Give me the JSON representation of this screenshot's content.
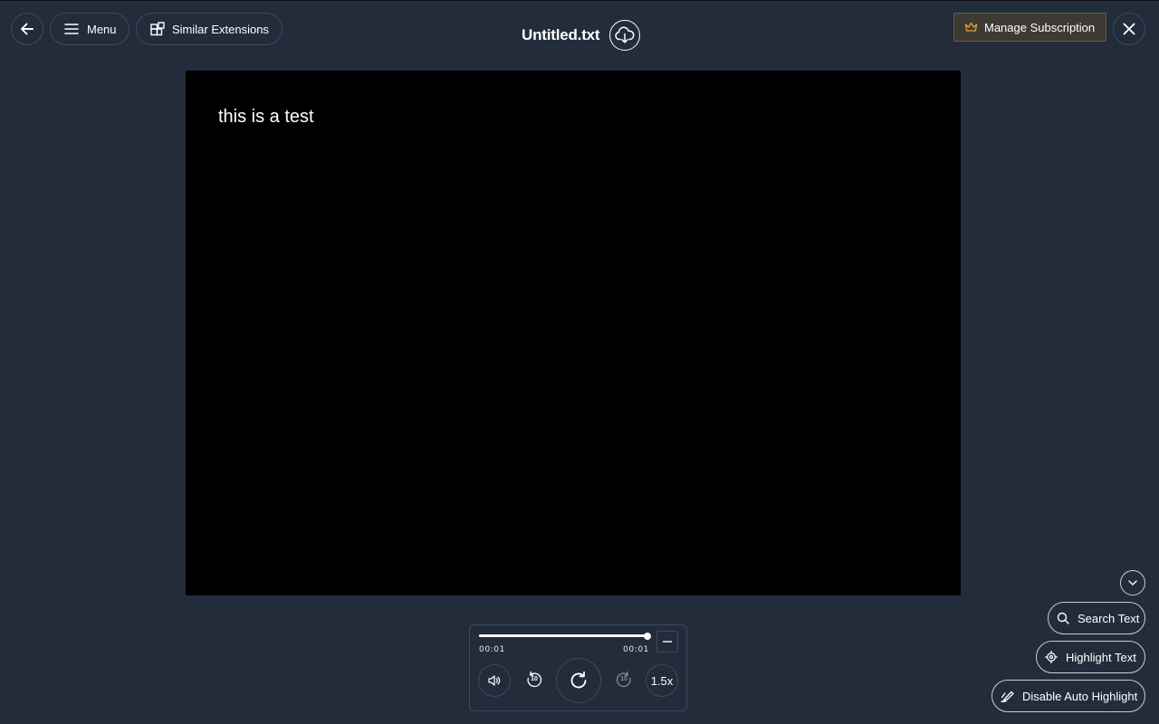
{
  "header": {
    "menu_label": "Menu",
    "similar_label": "Similar Extensions",
    "title": "Untitled.txt",
    "manage_label": "Manage Subscription",
    "icons": {
      "back": "arrow-left-icon",
      "menu": "hamburger-icon",
      "similar": "extensions-icon",
      "download": "cloud-download-icon",
      "crown": "crown-icon",
      "close": "close-icon"
    },
    "accent_color": "#e2a13c"
  },
  "document": {
    "text": "this is a test"
  },
  "player": {
    "progress": 1.0,
    "time_current": "00:01",
    "time_total": "00:01",
    "speed_label": "1.5x",
    "rewind_seconds": "10",
    "forward_seconds": "10",
    "icons": {
      "minimize": "minus-icon",
      "volume": "volume-icon",
      "rewind": "rewind-10-icon",
      "replay": "replay-icon",
      "forward": "forward-10-icon"
    }
  },
  "side_tools": {
    "search_label": "Search Text",
    "highlight_label": "Highlight Text",
    "auto_highlight_label": "Disable Auto Highlight",
    "icons": {
      "collapse": "chevron-down-icon",
      "search": "search-icon",
      "highlight": "target-icon",
      "auto_highlight": "highlighter-icon"
    }
  },
  "colors": {
    "background": "#222c3b",
    "document_background": "#000000",
    "border": "#3e4a5c"
  }
}
